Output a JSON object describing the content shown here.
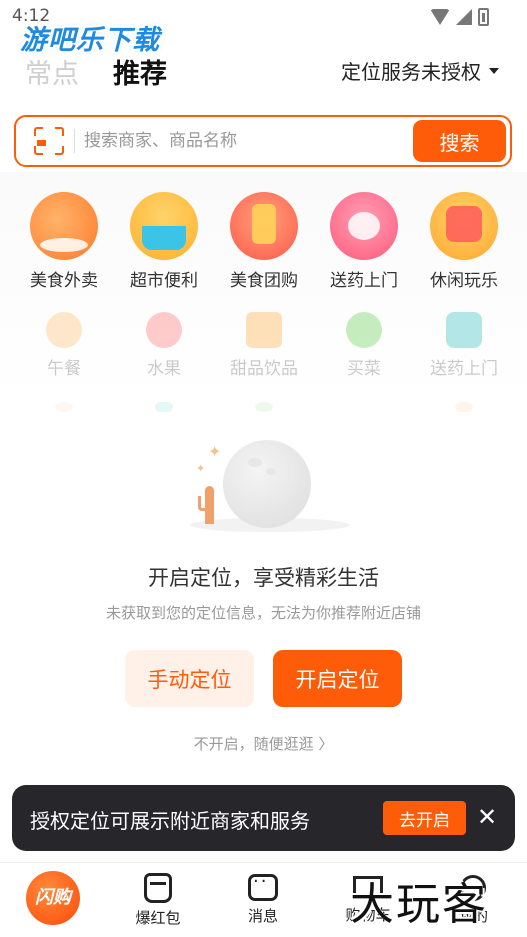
{
  "status_bar": {
    "time": "4:12"
  },
  "watermark": {
    "top": "游吧乐下载",
    "bottom": "大玩客"
  },
  "header": {
    "tabs": [
      {
        "label": "常点",
        "active": false
      },
      {
        "label": "推荐",
        "active": true
      }
    ],
    "location_status": "定位服务未授权"
  },
  "search": {
    "placeholder": "搜索商家、商品名称",
    "button_label": "搜索"
  },
  "categories": [
    {
      "label": "美食外卖",
      "icon": "food-delivery-icon"
    },
    {
      "label": "超市便利",
      "icon": "supermarket-icon"
    },
    {
      "label": "美食团购",
      "icon": "group-buy-icon"
    },
    {
      "label": "送药上门",
      "icon": "medicine-icon"
    },
    {
      "label": "休闲玩乐",
      "icon": "leisure-icon"
    }
  ],
  "sub_categories": [
    {
      "label": "午餐",
      "icon": "lunch-icon"
    },
    {
      "label": "水果",
      "icon": "strawberry-icon"
    },
    {
      "label": "甜品饮品",
      "icon": "drink-icon"
    },
    {
      "label": "买菜",
      "icon": "vegetable-icon"
    },
    {
      "label": "送药上门",
      "icon": "medicine-box-icon"
    }
  ],
  "location_prompt": {
    "title": "开启定位，享受精彩生活",
    "subtitle": "未获取到您的定位信息，无法为你推荐附近店铺",
    "manual_button": "手动定位",
    "enable_button": "开启定位",
    "skip_link": "不开启，随便逛逛 〉"
  },
  "toast": {
    "text": "授权定位可展示附近商家和服务",
    "button": "去开启",
    "close": "✕"
  },
  "bottom_nav": [
    {
      "label": "闪购",
      "icon": "flash-buy-icon"
    },
    {
      "label": "爆红包",
      "icon": "red-packet-icon"
    },
    {
      "label": "消息",
      "icon": "message-icon"
    },
    {
      "label": "购物车",
      "icon": "cart-icon"
    },
    {
      "label": "我的",
      "icon": "profile-icon"
    }
  ],
  "colors": {
    "accent": "#ff5c0a",
    "toast_bg": "#26262b"
  }
}
